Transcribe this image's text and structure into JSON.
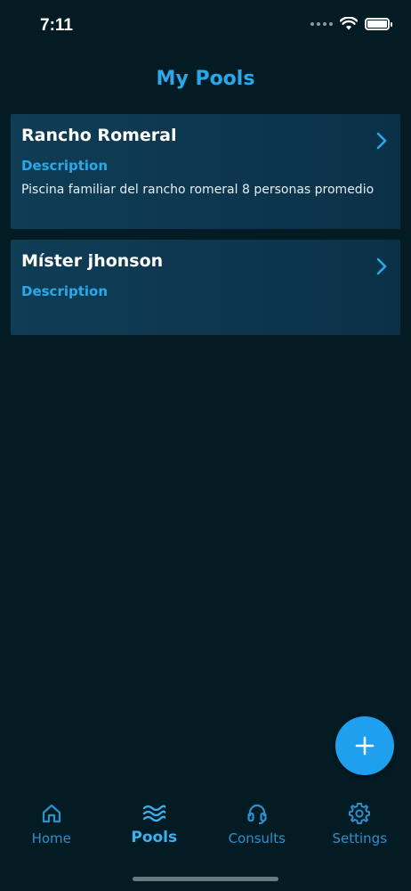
{
  "status_bar": {
    "time": "7:11",
    "icons": [
      "signal-dots-icon",
      "wifi-icon",
      "battery-icon"
    ]
  },
  "header": {
    "title": "My Pools"
  },
  "pools": [
    {
      "name": "Rancho Romeral",
      "description_label": "Description",
      "description": "Piscina familiar del rancho romeral 8 personas promedio"
    },
    {
      "name": "Míster jhonson",
      "description_label": "Description",
      "description": ""
    }
  ],
  "fab": {
    "icon": "plus-icon"
  },
  "tab_bar": {
    "active": "Pools",
    "tabs": [
      {
        "label": "Home",
        "icon": "home-icon"
      },
      {
        "label": "Pools",
        "icon": "waves-icon"
      },
      {
        "label": "Consults",
        "icon": "headset-icon"
      },
      {
        "label": "Settings",
        "icon": "gear-icon"
      }
    ]
  },
  "colors": {
    "background": "#031c24",
    "card": "#0f3d56",
    "accent": "#2aa9ea",
    "fab": "#1ea0ee"
  }
}
